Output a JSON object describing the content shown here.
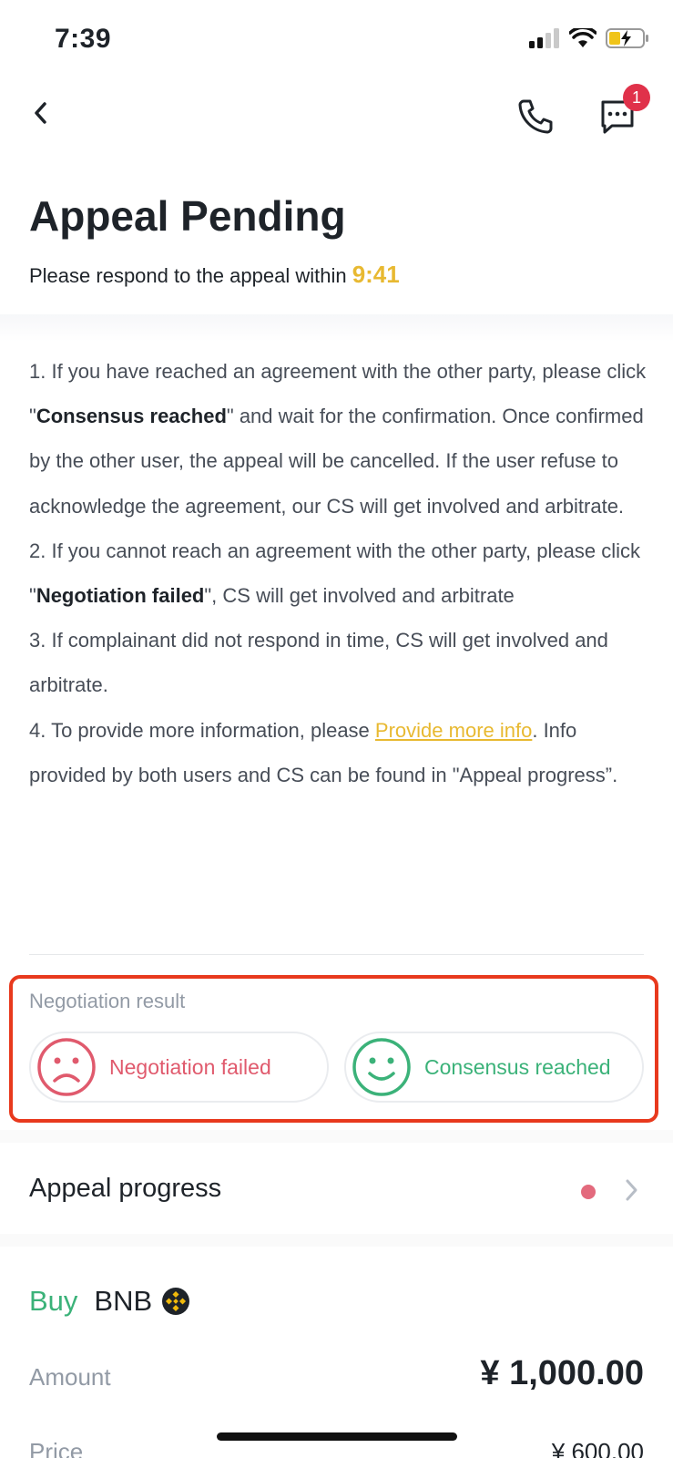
{
  "status_bar": {
    "time": "7:39"
  },
  "nav": {
    "message_badge": "1"
  },
  "header": {
    "title": "Appeal Pending",
    "subtitle_prefix": "Please respond to the appeal within ",
    "countdown": "9:41"
  },
  "instructions": {
    "p1_a": "1. If you have reached an agreement with the other party, please click \"",
    "p1_bold": "Consensus reached",
    "p1_b": "\" and wait for the confirmation. Once confirmed by the other user, the appeal will be cancelled. If the user refuse to acknowledge the agreement, our CS will get involved and arbitrate.",
    "p2_a": "2. If you cannot reach an agreement with the other party, please click \"",
    "p2_bold": "Negotiation failed",
    "p2_b": "\", CS will get involved and arbitrate",
    "p3": "3. If complainant did not respond in time, CS will get involved and arbitrate.",
    "p4_a": "4. To provide more information, please ",
    "p4_link": "Provide more info",
    "p4_b": ". Info provided by both users and CS can be found in \"Appeal progress”."
  },
  "negotiation": {
    "label": "Negotiation result",
    "failed_label": "Negotiation failed",
    "reached_label": "Consensus reached"
  },
  "appeal_progress": {
    "label": "Appeal progress"
  },
  "trade": {
    "side": "Buy",
    "asset": "BNB",
    "amount_label": "Amount",
    "amount_value": "¥ 1,000.00",
    "price_label": "Price",
    "price_value": "¥ 600.00"
  },
  "colors": {
    "accent_yellow": "#e8b931",
    "fail_red": "#e05a6d",
    "success_green": "#3bb279",
    "highlight_border": "#e8391d"
  },
  "icons": [
    "back-chevron-icon",
    "phone-icon",
    "chat-icon",
    "sad-face-icon",
    "smile-face-icon",
    "chevron-right-icon",
    "bnb-coin-icon"
  ]
}
